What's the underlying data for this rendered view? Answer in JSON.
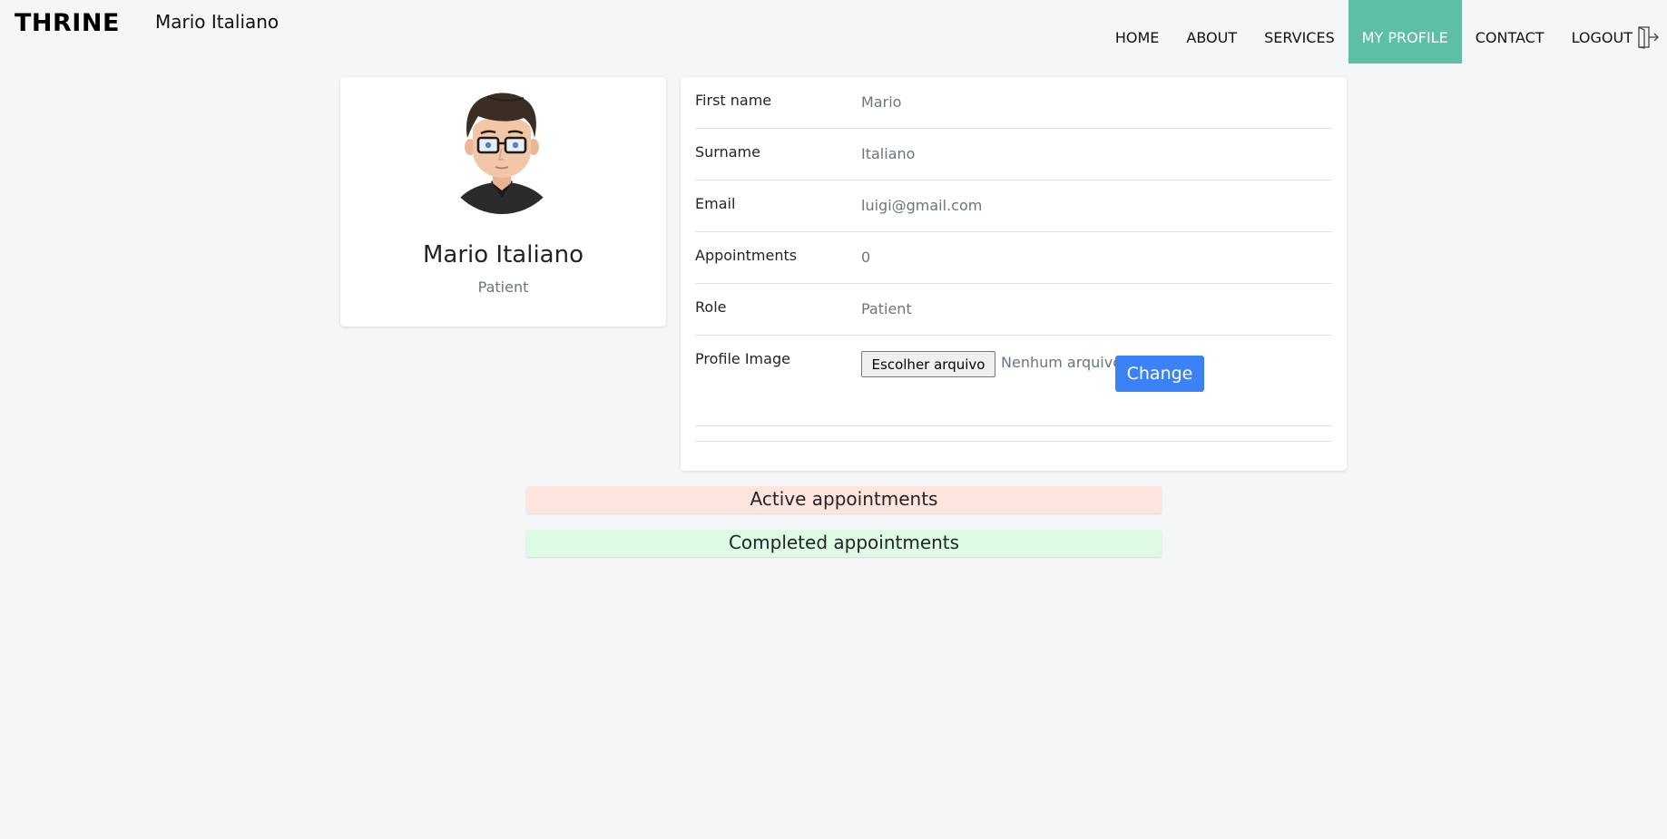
{
  "navbar": {
    "brand": "THRINE",
    "user_name": "Mario Italiano",
    "links": [
      {
        "label": "HOME"
      },
      {
        "label": "ABOUT"
      },
      {
        "label": "SERVICES"
      },
      {
        "label": "MY PROFILE",
        "active": true
      },
      {
        "label": "CONTACT"
      },
      {
        "label": "LOGOUT",
        "icon": "logout-icon"
      }
    ],
    "active_color": "#5cbfa6"
  },
  "profile_card": {
    "avatar_icon": "avatar-image",
    "name": "Mario Italiano",
    "role": "Patient"
  },
  "info": {
    "first_name_label": "First name",
    "first_name_value": "Mario",
    "surname_label": "Surname",
    "surname_value": "Italiano",
    "email_label": "Email",
    "email_value": "luigi@gmail.com",
    "appointments_label": "Appointments",
    "appointments_value": "0",
    "role_label": "Role",
    "role_value": "Patient",
    "profile_image_label": "Profile Image",
    "file_button_label": "Escolher arquivo",
    "file_status": "Nenhum arquivo escolhido",
    "change_button_label": "Change",
    "change_button_color": "#3b82f6"
  },
  "sections": {
    "active_label": "Active appointments",
    "active_color": "#fde5dd",
    "completed_label": "Completed appointments",
    "completed_color": "#ddfbe3"
  }
}
